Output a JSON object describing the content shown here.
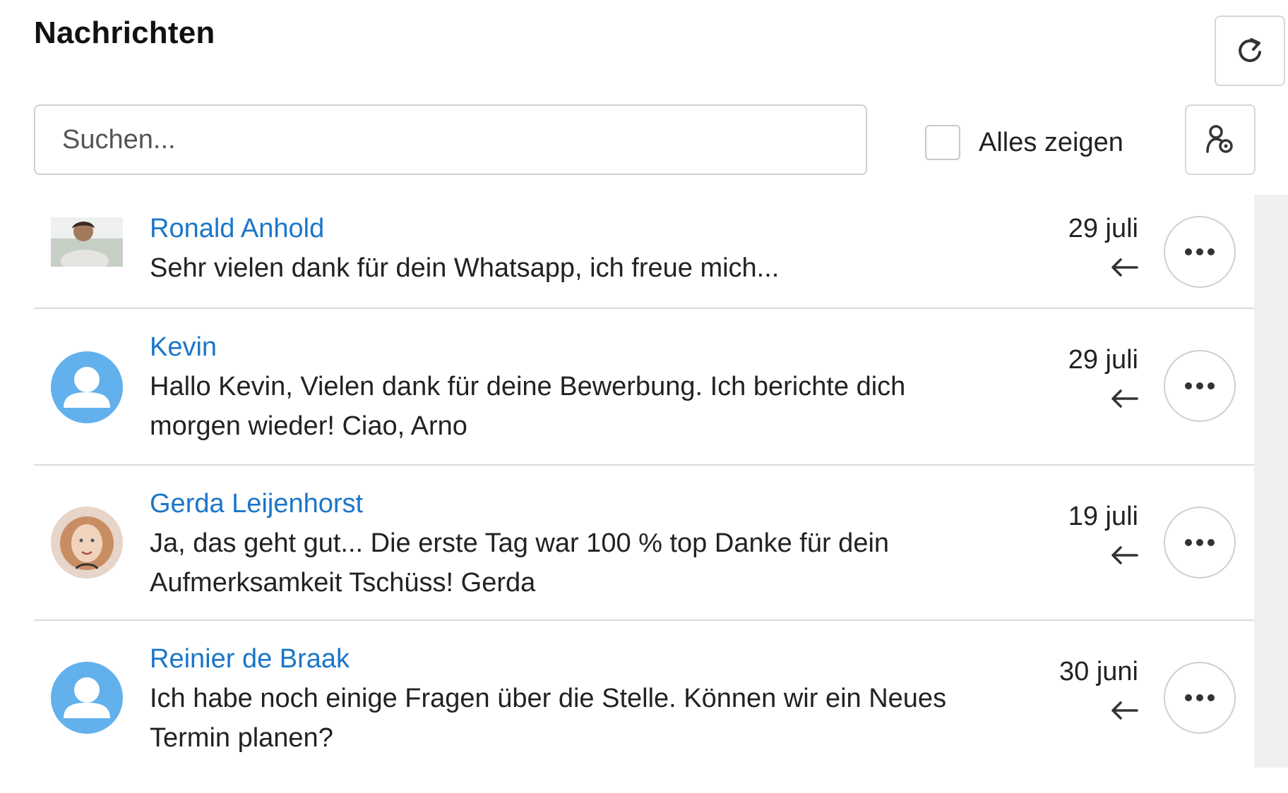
{
  "header": {
    "title": "Nachrichten"
  },
  "toolbar": {
    "search_placeholder": "Suchen...",
    "search_value": "",
    "show_all_label": "Alles zeigen",
    "show_all_checked": false
  },
  "messages": [
    {
      "sender": "Ronald Anhold",
      "preview": "Sehr vielen dank für dein Whatsapp, ich freue mich...",
      "date": "29 juli",
      "avatar": "photo"
    },
    {
      "sender": "Kevin",
      "preview": "Hallo Kevin, Vielen dank für deine Bewerbung. Ich berichte dich morgen wieder! Ciao, Arno",
      "date": "29 juli",
      "avatar": "default-user-icon"
    },
    {
      "sender": "Gerda Leijenhorst",
      "preview": "Ja, das geht gut... Die erste Tag war 100 % top Danke für dein Aufmerksamkeit Tschüss! Gerda",
      "date": "19 juli",
      "avatar": "photo"
    },
    {
      "sender": "Reinier de Braak",
      "preview": "Ich habe noch einige Fragen über die Stelle. Können wir ein Neues Termin planen?",
      "date": "30 juni",
      "avatar": "default-user-icon"
    }
  ],
  "icons": {
    "refresh": "refresh-icon",
    "user_settings": "user-settings-icon",
    "reply": "reply-arrow-icon",
    "more": "more-options-icon"
  },
  "colors": {
    "link": "#1b76c9",
    "avatar_default": "#62b0ec",
    "border": "#d7d7d7"
  }
}
